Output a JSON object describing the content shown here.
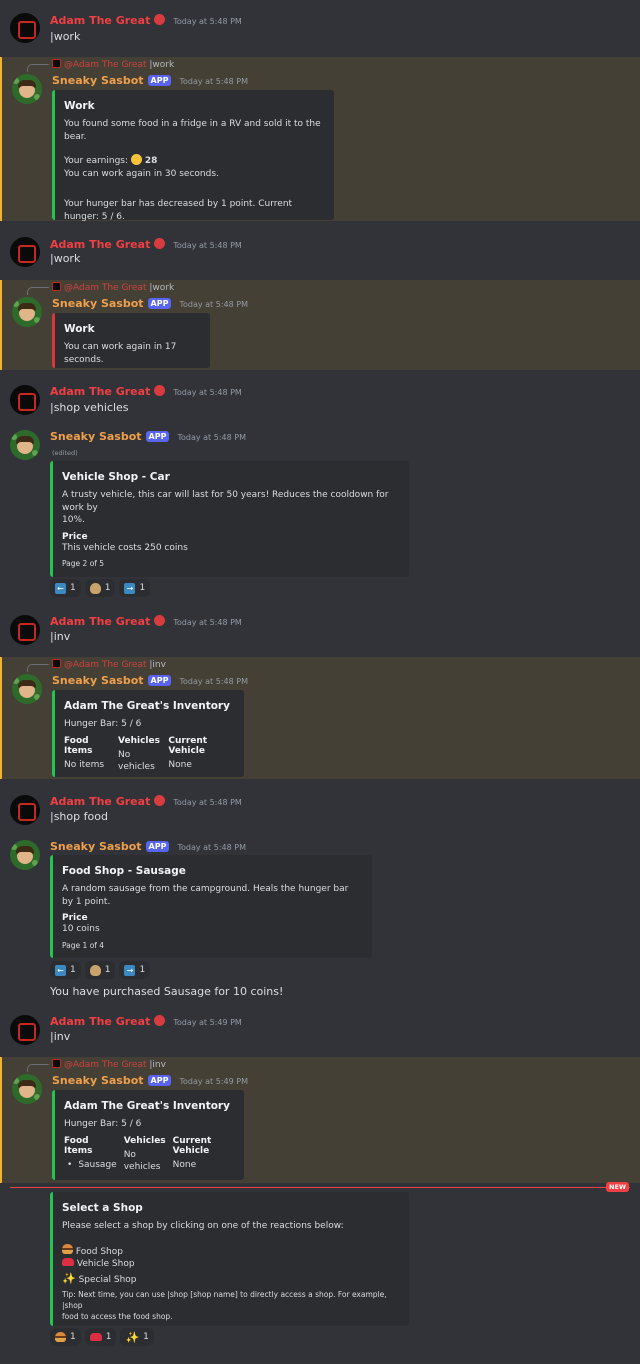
{
  "users": {
    "user_name": "Adam The Great",
    "bot_name": "Sneaky Sasbot",
    "app_badge": "APP",
    "reply_mention": "@Adam The Great"
  },
  "messages": {
    "m1": {
      "time": "Today at 5:48 PM",
      "text": "|work"
    },
    "m2": {
      "reply_text": "|work",
      "time": "Today at 5:48 PM",
      "embed_title": "Work",
      "line1": "You found some food in a fridge in a RV and sold it to the bear.",
      "earnings_label": "Your earnings:",
      "earnings_value": "28",
      "line3": "You can work again in 30 seconds.",
      "line4": "Your hunger bar has decreased by 1 point. Current hunger: 5 / 6."
    },
    "m3": {
      "time": "Today at 5:48 PM",
      "text": "|work"
    },
    "m4": {
      "reply_text": "|work",
      "time": "Today at 5:48 PM",
      "embed_title": "Work",
      "line1": "You can work again in 17 seconds."
    },
    "m5": {
      "time": "Today at 5:48 PM",
      "text": "|shop vehicles"
    },
    "m6": {
      "time": "Today at 5:48 PM",
      "edited": "(edited)",
      "embed_title": "Vehicle Shop - Car",
      "desc_line1": "A trusty vehicle, this car will last for 50 years! Reduces the cooldown for work by",
      "desc_line2": "10%.",
      "price_label": "Price",
      "price_value": "This vehicle costs 250 coins",
      "footer": "Page 2 of 5",
      "reactions": [
        "1",
        "1",
        "1"
      ]
    },
    "m7": {
      "time": "Today at 5:48 PM",
      "text": "|inv"
    },
    "m8": {
      "reply_text": "|inv",
      "time": "Today at 5:48 PM",
      "embed_title": "Adam The Great's Inventory",
      "hunger": "Hunger Bar: 5 / 6",
      "f1_label": "Food Items",
      "f1_value": "No items",
      "f2_label": "Vehicles",
      "f2_value": "No vehicles",
      "f3_label": "Current Vehicle",
      "f3_value": "None"
    },
    "m9": {
      "time": "Today at 5:48 PM",
      "text": "|shop food"
    },
    "m10": {
      "time": "Today at 5:48 PM",
      "embed_title": "Food Shop - Sausage",
      "desc": "A random sausage from the campground. Heals the hunger bar by 1 point.",
      "price_label": "Price",
      "price_value": "10 coins",
      "footer": "Page 1 of 4",
      "reactions": [
        "1",
        "1",
        "1"
      ],
      "followup": "You have purchased Sausage for 10 coins!"
    },
    "m11": {
      "time": "Today at 5:49 PM",
      "text": "|inv"
    },
    "m12": {
      "reply_text": "|inv",
      "time": "Today at 5:49 PM",
      "embed_title": "Adam The Great's Inventory",
      "hunger": "Hunger Bar: 5 / 6",
      "f1_label": "Food Items",
      "f1_item": "Sausage",
      "f2_label": "Vehicles",
      "f2_value": "No vehicles",
      "f3_label": "Current Vehicle",
      "f3_value": "None"
    },
    "m13": {
      "new_badge": "NEW",
      "embed_title": "Select a Shop",
      "desc": "Please select a shop by clicking on one of the reactions below:",
      "opt1": "Food Shop",
      "opt2": "Vehicle Shop",
      "opt3": "Special Shop",
      "tip_line1": "Tip: Next time, you can use |shop [shop name] to directly access a shop. For example, |shop",
      "tip_line2": "food to access the food shop.",
      "reactions": [
        "1",
        "1",
        "1"
      ]
    }
  },
  "icons": {
    "left_arrow": "arrow-left-icon",
    "money_bag": "money-bag-icon",
    "right_arrow": "arrow-right-icon",
    "burger": "hamburger-icon",
    "car": "car-icon",
    "sparkles": "sparkles-icon",
    "coin": "coin-icon",
    "globe": "globe-icon"
  },
  "colors": {
    "background": "#313338",
    "highlight": "#444036",
    "user_name": "#f23f43",
    "bot_name": "#f0a04b",
    "embed_green": "#23c552",
    "embed_red": "#da373c",
    "app_badge": "#5865f2"
  }
}
